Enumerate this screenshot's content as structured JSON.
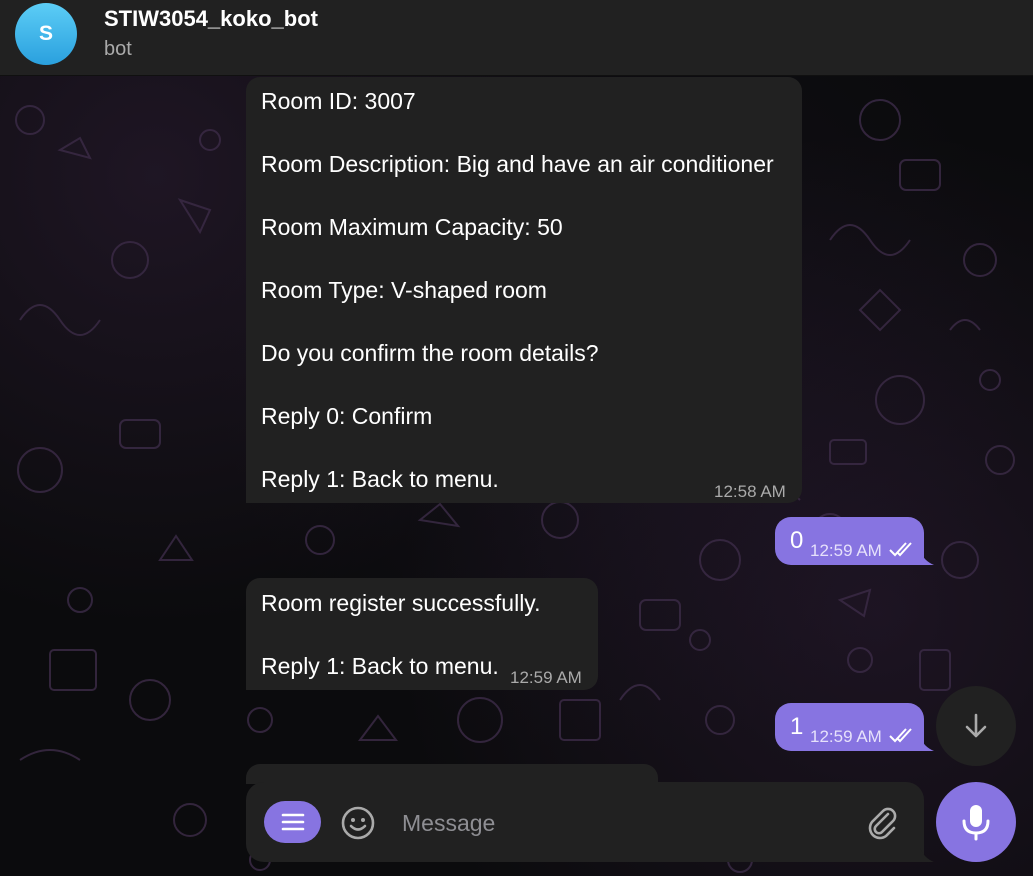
{
  "header": {
    "avatar_initial": "S",
    "title": "STIW3054_koko_bot",
    "subtitle": "bot"
  },
  "messages": [
    {
      "direction": "in",
      "lines": [
        "Room ID: 3007",
        "Room Description: Big and have an air conditioner",
        "Room Maximum Capacity: 50",
        "Room Type: V-shaped room",
        "Do you confirm the room details?",
        "Reply 0: Confirm",
        "Reply 1: Back to menu."
      ],
      "time": "12:58 AM"
    },
    {
      "direction": "out",
      "text": "0",
      "time": "12:59 AM",
      "status": "read"
    },
    {
      "direction": "in",
      "lines": [
        "Room register successfully.",
        "Reply 1: Back to menu."
      ],
      "time": "12:59 AM"
    },
    {
      "direction": "out",
      "text": "1",
      "time": "12:59 AM",
      "status": "read"
    }
  ],
  "composer": {
    "placeholder": "Message"
  },
  "icons": {
    "menu": "menu-icon",
    "emoji": "emoji-icon",
    "attach": "paperclip-icon",
    "mic": "microphone-icon",
    "scroll": "arrow-down-icon",
    "read_status": "double-check-icon"
  },
  "colors": {
    "accent": "#8774e1",
    "bubble_in": "#212121",
    "header_bg": "#212121",
    "avatar": "#3aaee6"
  }
}
